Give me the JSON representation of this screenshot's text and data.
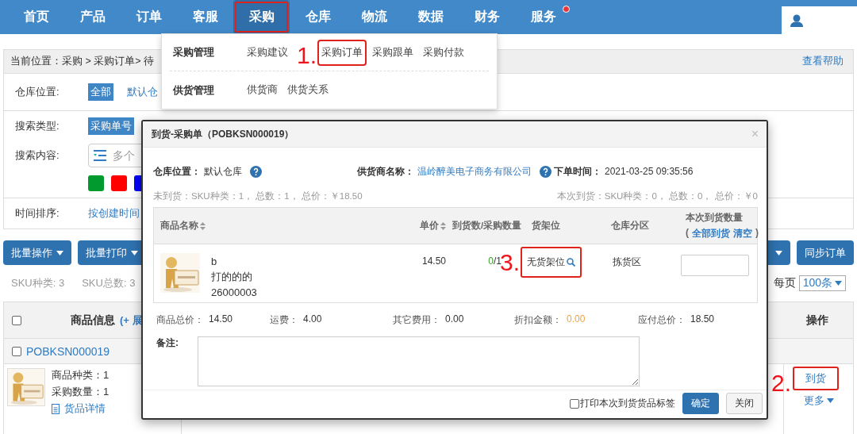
{
  "nav": {
    "items": [
      {
        "label": "首页",
        "selected": false,
        "marked": false,
        "has_dot": false
      },
      {
        "label": "产品",
        "selected": false,
        "marked": false,
        "has_dot": false
      },
      {
        "label": "订单",
        "selected": false,
        "marked": false,
        "has_dot": false
      },
      {
        "label": "客服",
        "selected": false,
        "marked": false,
        "has_dot": false
      },
      {
        "label": "采购",
        "selected": true,
        "marked": true,
        "has_dot": false
      },
      {
        "label": "仓库",
        "selected": false,
        "marked": false,
        "has_dot": false
      },
      {
        "label": "物流",
        "selected": false,
        "marked": false,
        "has_dot": false
      },
      {
        "label": "数据",
        "selected": false,
        "marked": false,
        "has_dot": false
      },
      {
        "label": "财务",
        "selected": false,
        "marked": false,
        "has_dot": false
      },
      {
        "label": "服务",
        "selected": false,
        "marked": false,
        "has_dot": true
      }
    ]
  },
  "breadcrumb": {
    "text": "当前位置：采购 > 采购订单> 待",
    "help": "查看帮助"
  },
  "filters": {
    "warehouse": {
      "label": "仓库位置:",
      "options": [
        {
          "label": "全部",
          "selected": true
        },
        {
          "label": "默认仓",
          "selected": false
        }
      ]
    },
    "search_type": {
      "label": "搜索类型:",
      "options": [
        {
          "label": "采购单号",
          "selected": true
        }
      ]
    },
    "search_content": {
      "label": "搜索内容:",
      "placeholder": "多个"
    },
    "color_tags": [
      {
        "color": "#009a2e"
      },
      {
        "color": "#ff0000"
      },
      {
        "color": "#0000ff"
      }
    ],
    "sort": {
      "label": "时间排序:",
      "option": "按创建时间"
    }
  },
  "toolbar": {
    "left": [
      {
        "kind": "menu",
        "label": "批量操作"
      },
      {
        "kind": "menu",
        "label": "批量打印"
      }
    ],
    "right": [
      {
        "kind": "caret"
      },
      {
        "kind": "plain",
        "label": "同步订单"
      }
    ]
  },
  "stats": [
    "SKU种类: 3",
    "SKU总数: 3"
  ],
  "page_size": {
    "label": "每页",
    "value": "100条"
  },
  "table": {
    "select_all_checked": false,
    "title": "商品信息",
    "expand": "(+ 展",
    "actions_header": "操作",
    "order": {
      "checked": false,
      "number": "POBKSN000019",
      "details": [
        "商品种类：1",
        "采购数量：1"
      ],
      "detail_link": "货品详情",
      "actions": [
        {
          "label": "到货",
          "kind": "link",
          "marked": true,
          "annotation": "2."
        },
        {
          "label": "更多",
          "kind": "menu",
          "marked": false
        }
      ]
    }
  },
  "dropdown": {
    "groups": [
      {
        "title": "采购管理",
        "items": [
          {
            "label": "采购建议",
            "marked": false
          },
          {
            "label": "采购订单",
            "marked": true,
            "annotation": "1."
          },
          {
            "label": "采购跟单",
            "marked": false
          },
          {
            "label": "采购付款",
            "marked": false
          }
        ]
      },
      {
        "title": "供货管理",
        "items": [
          {
            "label": "供货商",
            "marked": false
          },
          {
            "label": "供货关系",
            "marked": false
          }
        ]
      }
    ]
  },
  "modal": {
    "title": "到货-采购单（POBKSN000019）",
    "close_symbol": "×",
    "info": [
      {
        "label": "仓库位置：",
        "value": "默认仓库",
        "kind": "text",
        "help": true
      },
      {
        "label": "供货商名称：",
        "value": "温岭醉美电子商务有限公司",
        "kind": "link",
        "help": true
      },
      {
        "label": "下单时间：",
        "value": "2021-03-25 09:35:56",
        "kind": "text",
        "help": false
      }
    ],
    "summary_left": "未到货：SKU种类：1， 总数：1， 总价：￥18.50",
    "summary_right": "本次到货：SKU种类：0， 总数：0， 总价：￥0",
    "columns": [
      {
        "label": "商品名称",
        "sortable": true
      },
      {
        "label": "单价",
        "sortable": true
      },
      {
        "label": "到货数/采购数量",
        "sortable": false
      },
      {
        "label": "货架位",
        "sortable": false
      },
      {
        "label": "仓库分区",
        "sortable": false
      },
      {
        "label": "本次到货数量",
        "sortable": false
      }
    ],
    "bulk_prefix": "(",
    "bulk_links": [
      "全部到货",
      "清空"
    ],
    "bulk_suffix": ")",
    "rows": [
      {
        "name_lines": [
          "b",
          "打的的的",
          "26000003"
        ],
        "price": "14.50",
        "received": "0",
        "ordered": "/1",
        "shelf": "无货架位",
        "zone": "拣货区",
        "marked": true,
        "annotation": "3."
      }
    ],
    "totals": [
      {
        "label": "商品总价：",
        "value": "14.50",
        "highlight": false
      },
      {
        "label": "运费：",
        "value": "4.00",
        "highlight": false
      },
      {
        "label": "其它费用：",
        "value": "0.00",
        "highlight": false
      },
      {
        "label": "折扣金额：",
        "value": "0.00",
        "highlight": true
      },
      {
        "label": "应付总价：",
        "value": "18.50",
        "highlight": false
      }
    ],
    "remark_label": "备注:",
    "print_option": {
      "label": "打印本次到货货品标签",
      "checked": false
    },
    "buttons": [
      {
        "label": "确定",
        "kind": "primary"
      },
      {
        "label": "关闭",
        "kind": "default"
      }
    ]
  }
}
